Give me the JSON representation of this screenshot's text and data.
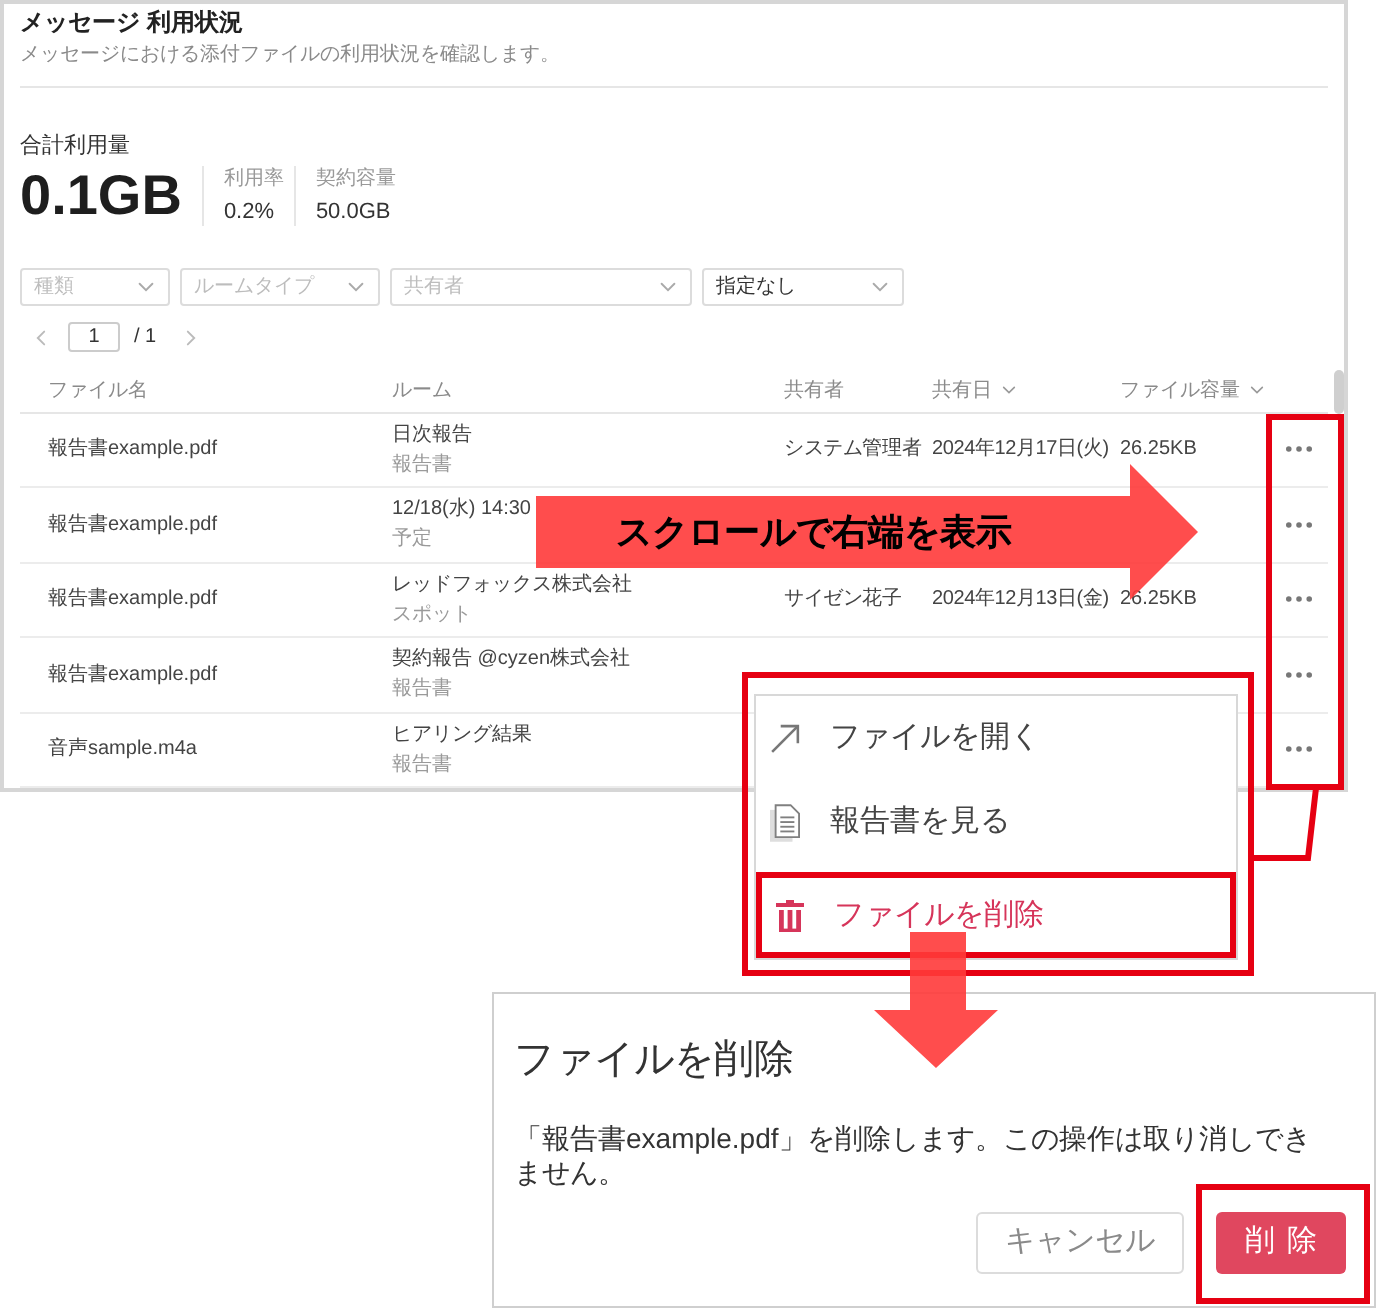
{
  "page": {
    "title": "メッセージ 利用状況",
    "description": "メッセージにおける添付ファイルの利用状況を確認します。"
  },
  "usage": {
    "label": "合計利用量",
    "total": "0.1GB",
    "stats": [
      {
        "label": "利用率",
        "value": "0.2%"
      },
      {
        "label": "契約容量",
        "value": "50.0GB"
      }
    ]
  },
  "filters": [
    {
      "placeholder": "種類"
    },
    {
      "placeholder": "ルームタイプ"
    },
    {
      "placeholder": "共有者"
    },
    {
      "value": "指定なし"
    }
  ],
  "pagination": {
    "page": "1",
    "total": "/ 1"
  },
  "table": {
    "columns": [
      {
        "label": "ファイル名",
        "sortable": false
      },
      {
        "label": "ルーム",
        "sortable": false
      },
      {
        "label": "共有者",
        "sortable": false
      },
      {
        "label": "共有日",
        "sortable": true
      },
      {
        "label": "ファイル容量",
        "sortable": true
      }
    ],
    "rows": [
      {
        "file": "報告書example.pdf",
        "room": "日次報告",
        "room_type": "報告書",
        "sharer": "システム管理者",
        "date": "2024年12月17日(火)",
        "size": "26.25KB"
      },
      {
        "file": "報告書example.pdf",
        "room": "12/18(水) 14:30",
        "room_type": "予定"
      },
      {
        "file": "報告書example.pdf",
        "room": "レッドフォックス株式会社",
        "room_type": "スポット",
        "sharer": "サイゼン花子",
        "date": "2024年12月13日(金)",
        "size": "26.25KB"
      },
      {
        "file": "報告書example.pdf",
        "room": "契約報告 @cyzen株式会社",
        "room_type": "報告書"
      },
      {
        "file": "音声sample.m4a",
        "room": "ヒアリング結果",
        "room_type": "報告書"
      }
    ]
  },
  "scroll_hint": "スクロールで右端を表示",
  "menu": {
    "items": [
      {
        "kind": "open",
        "label": "ファイルを開く",
        "highlighted": false
      },
      {
        "kind": "view",
        "label": "報告書を見る",
        "highlighted": false
      },
      {
        "kind": "delete",
        "label": "ファイルを削除",
        "highlighted": true
      }
    ]
  },
  "dialog": {
    "title": "ファイルを削除",
    "message": "「報告書example.pdf」を削除します。この操作は取り消しできません。",
    "buttons": [
      {
        "kind": "secondary",
        "label": "キャンセル",
        "highlighted": false
      },
      {
        "kind": "danger",
        "label": "削除",
        "highlighted": true
      }
    ]
  }
}
